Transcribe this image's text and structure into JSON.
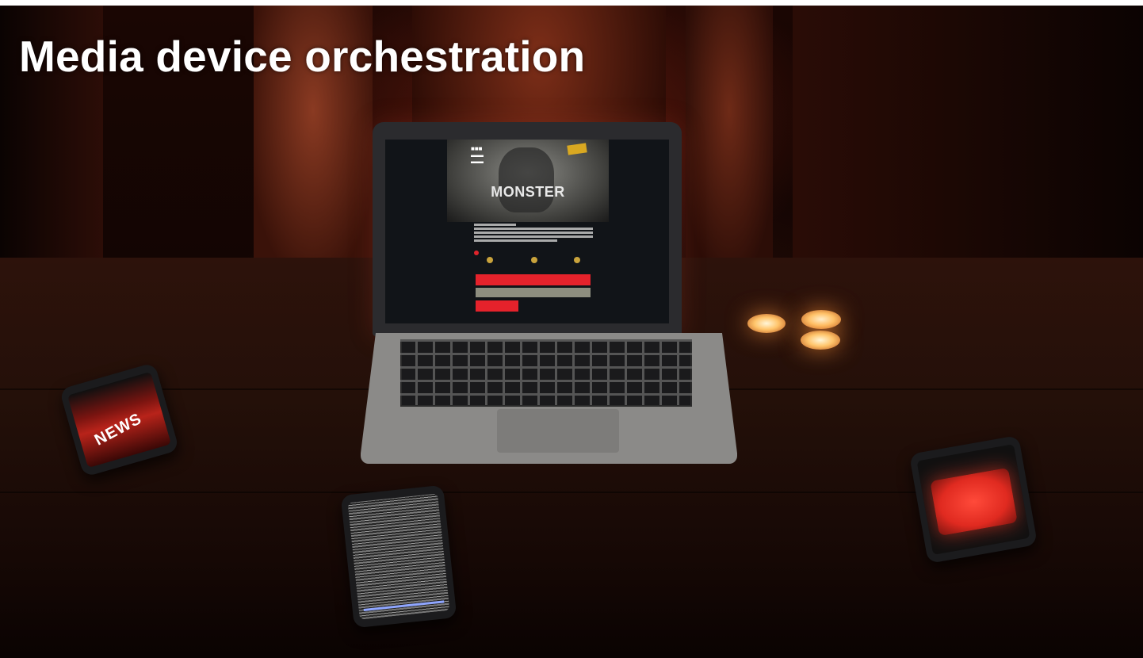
{
  "title": "Media device orchestration",
  "laptop": {
    "screen_title": "MONSTER"
  },
  "phones": {
    "left_app": "NEWS"
  }
}
